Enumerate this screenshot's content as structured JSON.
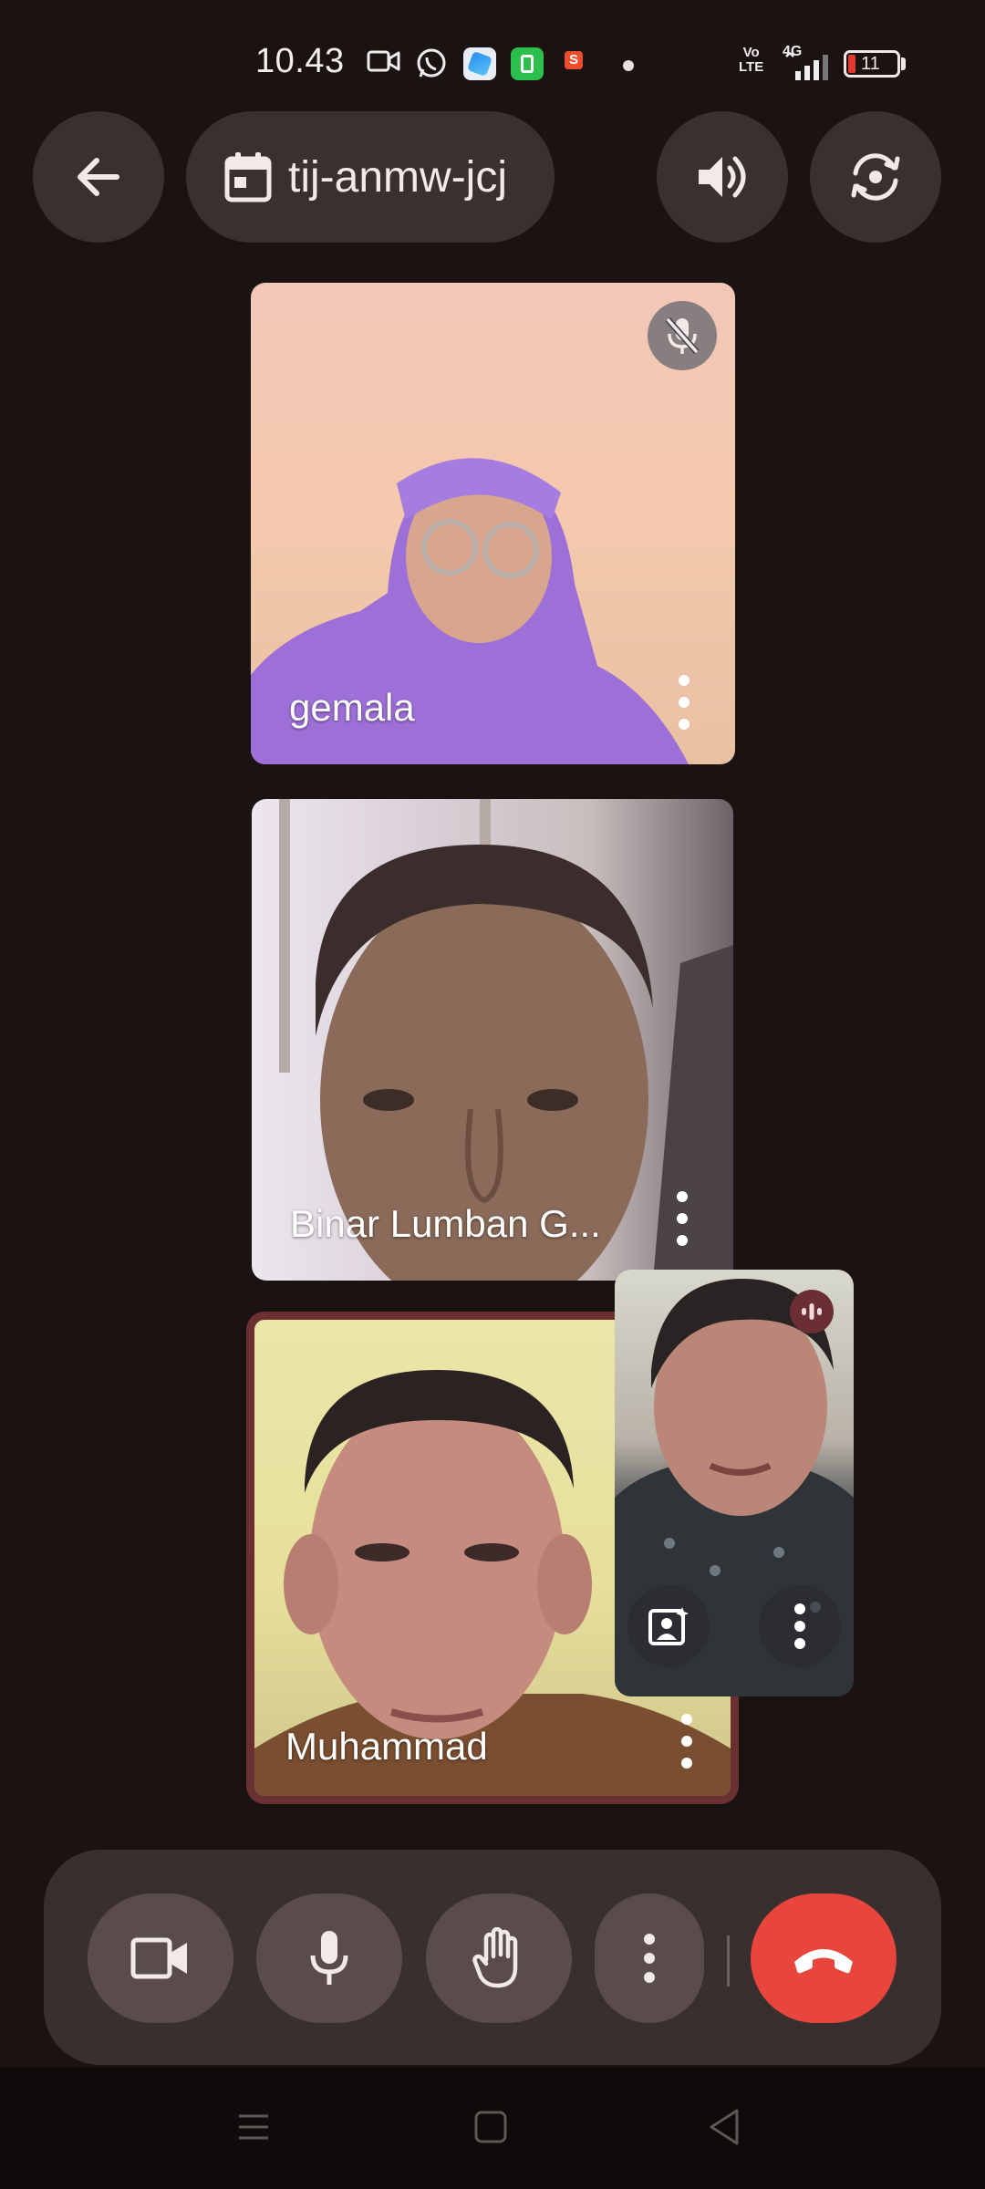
{
  "status_bar": {
    "time": "10.43",
    "network_type": "4G",
    "volte_line1": "Vo",
    "volte_line2": "LTE",
    "battery": "11",
    "app_icons": [
      "video-icon",
      "whatsapp-icon",
      "browser-app-icon",
      "green-app-icon",
      "shopeepay-icon"
    ]
  },
  "top_bar": {
    "meeting_code": "tij-anmw-jcj",
    "icons": [
      "back-arrow-icon",
      "calendar-icon",
      "speaker-icon",
      "switch-camera-icon"
    ]
  },
  "participants": [
    {
      "name": "gemala",
      "muted": true
    },
    {
      "name": "Binar Lumban G...",
      "muted": false
    },
    {
      "name": "Muhammad",
      "muted": false,
      "speaking_highlight": true
    }
  ],
  "self_view": {
    "icons": [
      "audio-level-icon",
      "effects-icon",
      "more-vert-icon"
    ]
  },
  "controls": {
    "buttons": [
      "camera",
      "microphone",
      "raise-hand",
      "more-options",
      "end-call"
    ]
  },
  "colors": {
    "background": "#1b1212",
    "control_bar": "#3a2f2f",
    "end_call": "#e8453c",
    "active_speaker_border": "#6a2f30"
  }
}
